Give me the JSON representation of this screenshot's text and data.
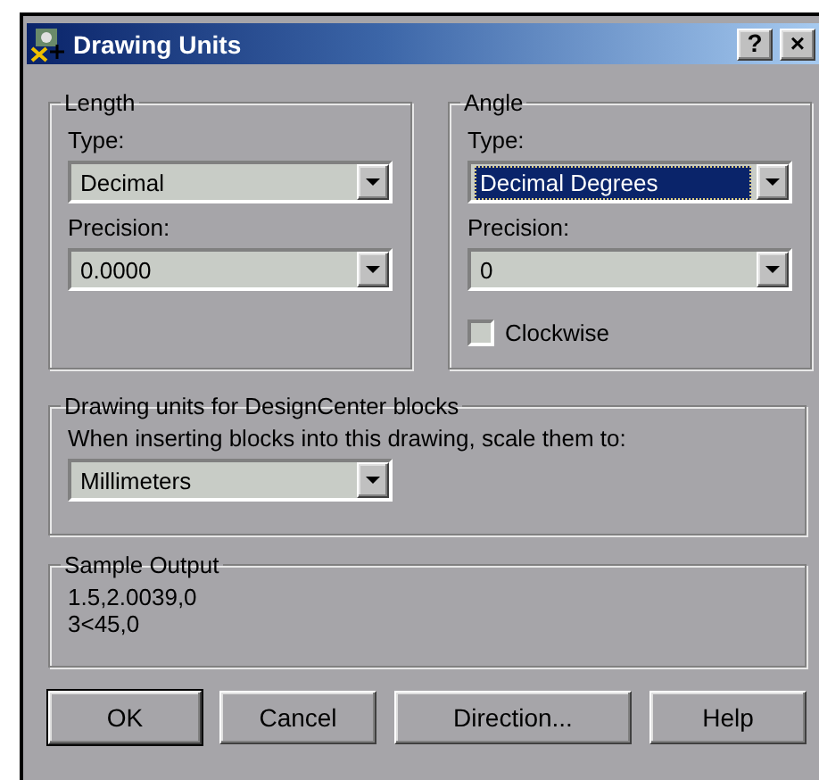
{
  "window": {
    "title": "Drawing Units"
  },
  "title_buttons": [
    {
      "label": "?"
    },
    {
      "label": "×"
    }
  ],
  "length": {
    "title": "Length",
    "type": {
      "label": "Type:",
      "value": "Decimal",
      "highlighted": false
    },
    "precision": {
      "label": "Precision:",
      "value": "0.0000",
      "highlighted": false
    }
  },
  "angle": {
    "title": "Angle",
    "type": {
      "label": "Type:",
      "value": "Decimal Degrees",
      "highlighted": true
    },
    "precision": {
      "label": "Precision:",
      "value": "0",
      "highlighted": false
    },
    "clockwise": {
      "label": "Clockwise",
      "checked": false
    }
  },
  "designcenter": {
    "title": "Drawing units for DesignCenter blocks",
    "prompt": "When inserting blocks into this drawing, scale them to:",
    "units": {
      "value": "Millimeters",
      "highlighted": false
    }
  },
  "sample_output": {
    "title": "Sample Output",
    "lines": [
      "1.5,2.0039,0",
      "3<45,0"
    ]
  },
  "buttons": [
    {
      "label": "OK",
      "default": true
    },
    {
      "label": "Cancel",
      "default": false
    },
    {
      "label": "Direction...",
      "default": false
    },
    {
      "label": "Help",
      "default": false
    }
  ]
}
